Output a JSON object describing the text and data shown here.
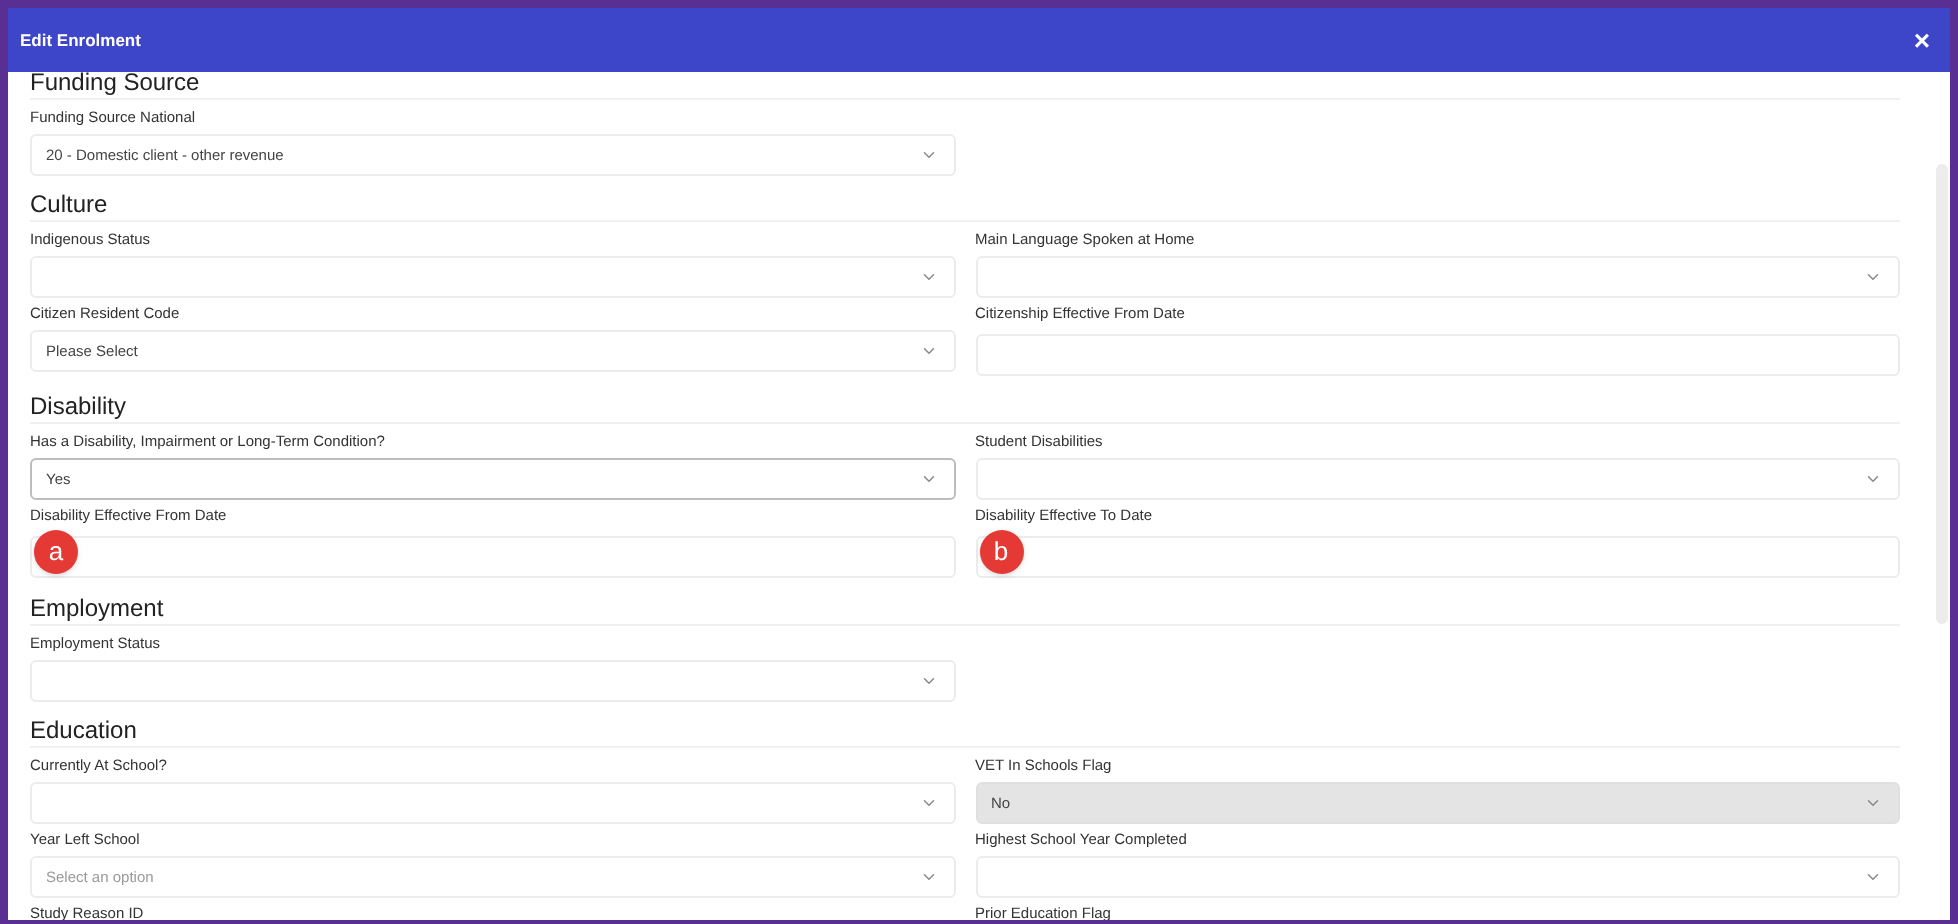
{
  "dialog": {
    "title": "Edit Enrolment",
    "close": "×"
  },
  "sections": [
    {
      "heading": "Funding Source",
      "rows": [
        [
          {
            "label": "Funding Source National",
            "kind": "select",
            "value": "20 - Domestic client - other revenue",
            "disabled": false
          }
        ]
      ]
    },
    {
      "heading": "Culture",
      "rows": [
        [
          {
            "label": "Indigenous Status",
            "kind": "select",
            "disabled": false
          },
          {
            "label": "Main Language Spoken at Home",
            "kind": "select",
            "disabled": false
          }
        ],
        [
          {
            "label": "Citizen Resident Code",
            "kind": "select",
            "value": "Please Select",
            "disabled": false
          },
          {
            "label": "Citizenship Effective From Date",
            "kind": "text",
            "disabled": false
          }
        ]
      ]
    },
    {
      "heading": "Disability",
      "rows": [
        [
          {
            "label": "Has a Disability, Impairment or Long-Term Condition?",
            "kind": "select",
            "value": "Yes",
            "disabled": false,
            "focused": true
          },
          {
            "label": "Student Disabilities",
            "kind": "select",
            "disabled": false
          }
        ],
        [
          {
            "label": "Disability Effective From Date",
            "kind": "text",
            "disabled": false,
            "marker": "a"
          },
          {
            "label": "Disability Effective To Date",
            "kind": "text",
            "disabled": false,
            "marker": "b"
          }
        ]
      ]
    },
    {
      "heading": "Employment",
      "rows": [
        [
          {
            "label": "Employment Status",
            "kind": "select",
            "disabled": false
          }
        ]
      ]
    },
    {
      "heading": "Education",
      "rows": [
        [
          {
            "label": "Currently At School?",
            "kind": "select",
            "disabled": false
          },
          {
            "label": "VET In Schools Flag",
            "kind": "select",
            "value": "No",
            "disabled": true
          }
        ],
        [
          {
            "label": "Year Left School",
            "kind": "select",
            "placeholder": "Select an option",
            "disabled": false
          },
          {
            "label": "Highest School Year Completed",
            "kind": "select",
            "disabled": false
          }
        ],
        [
          {
            "label": "Study Reason ID",
            "kind": "label"
          },
          {
            "label": "Prior Education Flag",
            "kind": "label"
          }
        ]
      ]
    }
  ]
}
